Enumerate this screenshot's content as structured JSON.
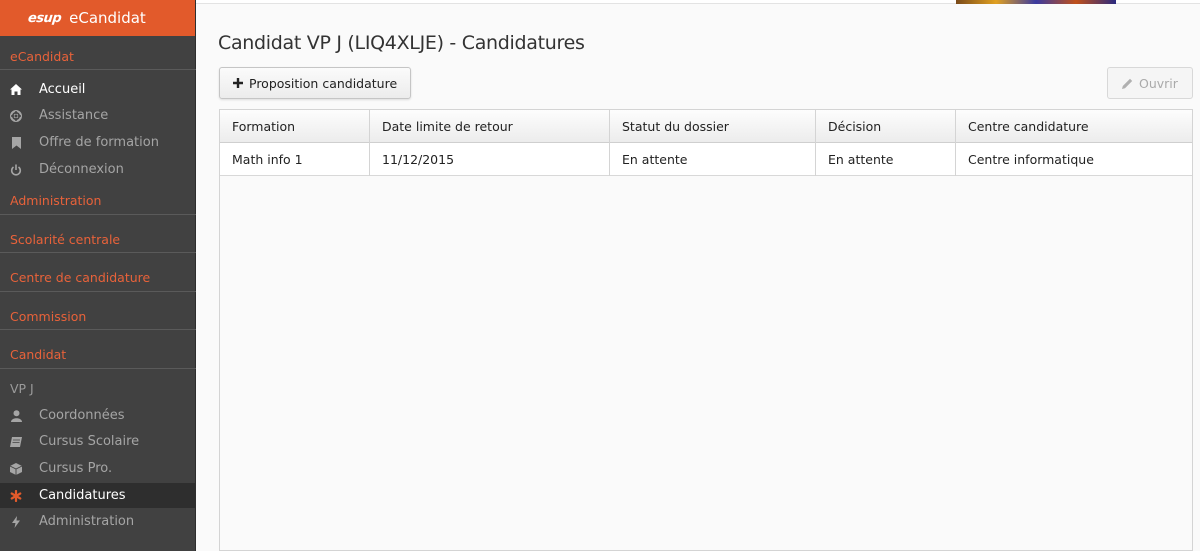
{
  "app": {
    "logo": "esup",
    "title": "eCandidat"
  },
  "sidebar": {
    "section_ecandidat": "eCandidat",
    "menu": [
      {
        "label": "Accueil",
        "icon": "home-icon"
      },
      {
        "label": "Assistance",
        "icon": "lifebuoy-icon"
      },
      {
        "label": "Offre de formation",
        "icon": "bookmark-icon"
      },
      {
        "label": "Déconnexion",
        "icon": "power-icon"
      }
    ],
    "sections": [
      "Administration",
      "Scolarité centrale",
      "Centre de candidature",
      "Commission",
      "Candidat"
    ],
    "user": "VP J",
    "candidat_menu": [
      {
        "label": "Coordonnées",
        "icon": "user-icon"
      },
      {
        "label": "Cursus Scolaire",
        "icon": "book-icon"
      },
      {
        "label": "Cursus Pro.",
        "icon": "cube-icon"
      },
      {
        "label": "Candidatures",
        "icon": "asterisk-icon"
      },
      {
        "label": "Administration",
        "icon": "bolt-icon"
      }
    ]
  },
  "page": {
    "title": "Candidat VP J (LIQ4XLJE) - Candidatures",
    "propose_button": "Proposition candidature",
    "open_button": "Ouvrir"
  },
  "table": {
    "columns": [
      "Formation",
      "Date limite de retour",
      "Statut du dossier",
      "Décision",
      "Centre candidature"
    ],
    "rows": [
      [
        "Math info 1",
        "11/12/2015",
        "En attente",
        "En attente",
        "Centre informatique"
      ]
    ]
  },
  "colors": {
    "accent": "#e25a2b",
    "sidebar": "#414141",
    "section": "#e8623a"
  }
}
